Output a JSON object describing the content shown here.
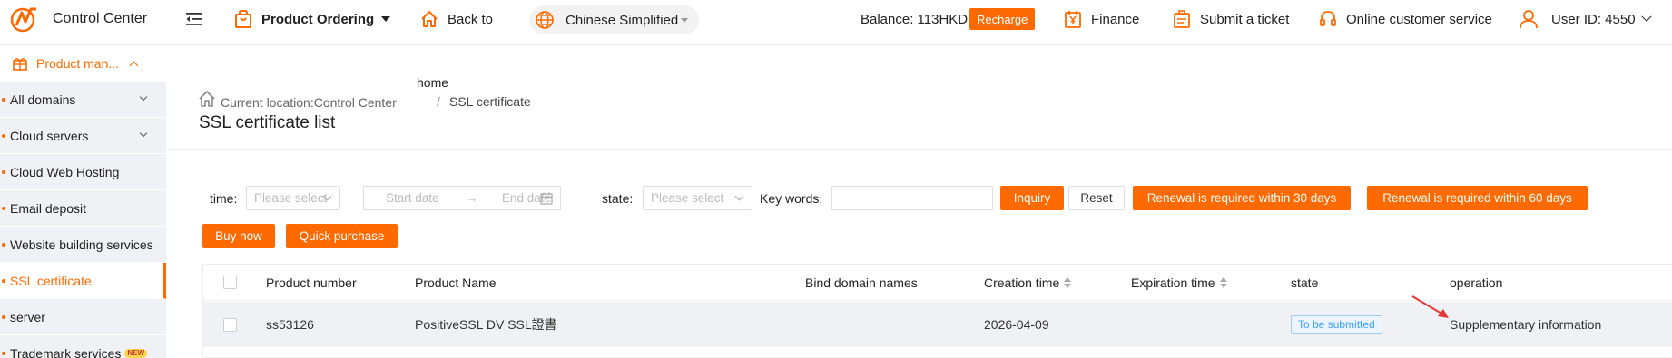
{
  "header": {
    "app_title": "Control Center",
    "product_ordering": "Product Ordering",
    "back_to": "Back to",
    "language": "Chinese Simplified",
    "balance": "Balance: 113HKD",
    "recharge": "Recharge",
    "finance": "Finance",
    "submit_ticket": "Submit a ticket",
    "online_service": "Online customer service",
    "user_id": "User ID: 4550"
  },
  "colors": {
    "accent": "#ff6a00",
    "status_blue": "#409eff"
  },
  "sidebar": {
    "group_label": "Product man...",
    "items": [
      {
        "label": "All domains",
        "expandable": true
      },
      {
        "label": "Cloud servers",
        "expandable": true
      },
      {
        "label": "Cloud Web Hosting"
      },
      {
        "label": "Email deposit"
      },
      {
        "label": "Website building services"
      },
      {
        "label": "SSL certificate",
        "active": true
      },
      {
        "label": "server"
      },
      {
        "label": "Trademark services",
        "badge": "NEW"
      }
    ]
  },
  "breadcrumb": {
    "current_location": "Current location:Control Center",
    "home": "home",
    "separator": "/",
    "page": "SSL certificate"
  },
  "page_title": "SSL certificate list",
  "filters": {
    "time_label": "time",
    "time_placeholder": "Please select",
    "start_date": "Start date",
    "range_arrow": "→",
    "end_date": "End date",
    "state_label": "state",
    "state_placeholder": "Please select",
    "keywords_label": "Key words",
    "keywords_value": "",
    "inquiry": "Inquiry",
    "reset": "Reset",
    "renew_30": "Renewal is required within 30 days",
    "renew_60": "Renewal is required within 60 days",
    "buy_now": "Buy now",
    "quick_purchase": "Quick purchase"
  },
  "table": {
    "columns": [
      "Product number",
      "Product Name",
      "Bind domain names",
      "Creation time",
      "Expiration time",
      "state",
      "operation"
    ],
    "rows": [
      {
        "product_number": "ss53126",
        "product_name": "PositiveSSL DV SSL證書",
        "bind_domains": "",
        "creation_time": "2026-04-09",
        "expiration_time": "",
        "state": "To be submitted",
        "operation": "Supplementary information"
      }
    ]
  }
}
